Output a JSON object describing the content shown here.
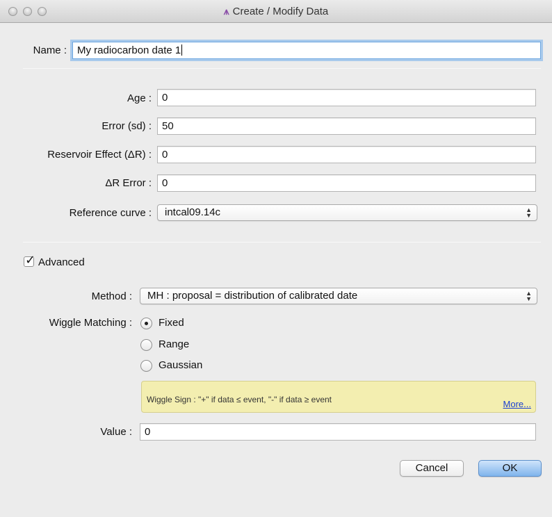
{
  "window": {
    "title": "Create / Modify Data",
    "app_icon": "app-logo-icon"
  },
  "name": {
    "label": "Name :",
    "value": "My radiocarbon date 1"
  },
  "age": {
    "label": "Age :",
    "value": "0"
  },
  "error": {
    "label": "Error (sd) :",
    "value": "50"
  },
  "reservoir": {
    "label": "Reservoir Effect (ΔR) :",
    "value": "0"
  },
  "dr_error": {
    "label": "ΔR Error :",
    "value": "0"
  },
  "reference_curve": {
    "label": "Reference curve :",
    "value": "intcal09.14c"
  },
  "advanced": {
    "label": "Advanced",
    "checked": true
  },
  "method": {
    "label": "Method :",
    "value": "MH : proposal = distribution of calibrated date"
  },
  "wiggle": {
    "label": "Wiggle Matching :",
    "options": [
      {
        "label": "Fixed",
        "selected": true
      },
      {
        "label": "Range",
        "selected": false
      },
      {
        "label": "Gaussian",
        "selected": false
      }
    ],
    "note": "Wiggle Sign : \"+\" if data ≤ event, \"-\" if data ≥ event",
    "more_link": "More..."
  },
  "value": {
    "label": "Value :",
    "value": "0"
  },
  "buttons": {
    "cancel": "Cancel",
    "ok": "OK"
  },
  "colors": {
    "ok_button": "#7fb4ec",
    "note_background": "#f3eeb0",
    "link": "#1a3fd1",
    "focus_ring": "#a9caec"
  }
}
